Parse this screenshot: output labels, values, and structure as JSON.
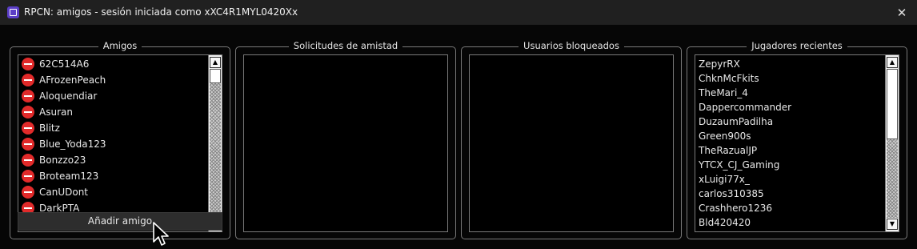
{
  "window": {
    "title": "RPCN: amigos - sesión iniciada como xXC4R1MYL0420Xx",
    "icon": "rpcs3-app-icon",
    "close_glyph": "✕"
  },
  "groups": {
    "friends": {
      "title": "Amigos",
      "items": [
        "62C514A6",
        "AFrozenPeach",
        "Aloquendiar",
        "Asuran",
        "Blitz",
        "Blue_Yoda123",
        "Bonzzo23",
        "Broteam123",
        "CanUDont",
        "DarkPTA"
      ],
      "status_icon": "offline-status-icon",
      "add_button_label": "Añadir amigo"
    },
    "requests": {
      "title": "Solicitudes de amistad",
      "items": []
    },
    "blocked": {
      "title": "Usuarios bloqueados",
      "items": []
    },
    "recent": {
      "title": "Jugadores recientes",
      "items": [
        "ZepyrRX",
        "ChknMcFkits",
        "TheMari_4",
        "Dappercommander",
        "DuzaumPadilha",
        "Green900s",
        "TheRazualJP",
        "YTCX_CJ_Gaming",
        "xLuigi77x_",
        "carlos310385",
        "Crashhero1236",
        "Bld420420"
      ]
    }
  },
  "scroll": {
    "friends_position": 0.0,
    "recent_position": 1.0
  },
  "colors": {
    "status_offline": "#e12a2a",
    "app_icon": "#5b3ec7",
    "titlebar": "#202020",
    "border": "#7a7a7a"
  }
}
